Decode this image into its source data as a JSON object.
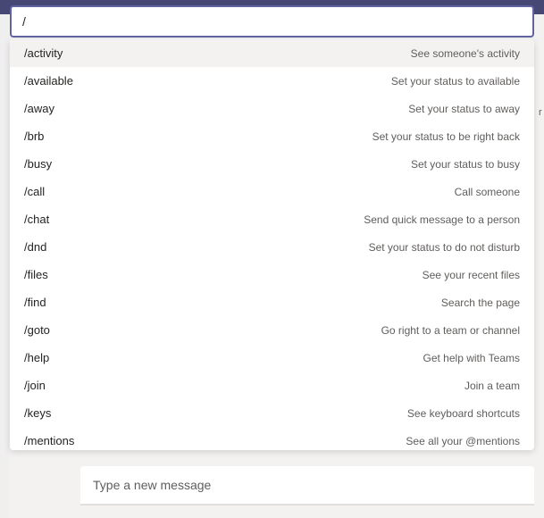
{
  "search": {
    "value": "/"
  },
  "commands": [
    {
      "cmd": "/activity",
      "desc": "See someone's activity",
      "selected": true
    },
    {
      "cmd": "/available",
      "desc": "Set your status to available",
      "selected": false
    },
    {
      "cmd": "/away",
      "desc": "Set your status to away",
      "selected": false
    },
    {
      "cmd": "/brb",
      "desc": "Set your status to be right back",
      "selected": false
    },
    {
      "cmd": "/busy",
      "desc": "Set your status to busy",
      "selected": false
    },
    {
      "cmd": "/call",
      "desc": "Call someone",
      "selected": false
    },
    {
      "cmd": "/chat",
      "desc": "Send quick message to a person",
      "selected": false
    },
    {
      "cmd": "/dnd",
      "desc": "Set your status to do not disturb",
      "selected": false
    },
    {
      "cmd": "/files",
      "desc": "See your recent files",
      "selected": false
    },
    {
      "cmd": "/find",
      "desc": "Search the page",
      "selected": false
    },
    {
      "cmd": "/goto",
      "desc": "Go right to a team or channel",
      "selected": false
    },
    {
      "cmd": "/help",
      "desc": "Get help with Teams",
      "selected": false
    },
    {
      "cmd": "/join",
      "desc": "Join a team",
      "selected": false
    },
    {
      "cmd": "/keys",
      "desc": "See keyboard shortcuts",
      "selected": false
    },
    {
      "cmd": "/mentions",
      "desc": "See all your @mentions",
      "selected": false
    }
  ],
  "composer": {
    "placeholder": "Type a new message"
  },
  "edge_char": "r"
}
